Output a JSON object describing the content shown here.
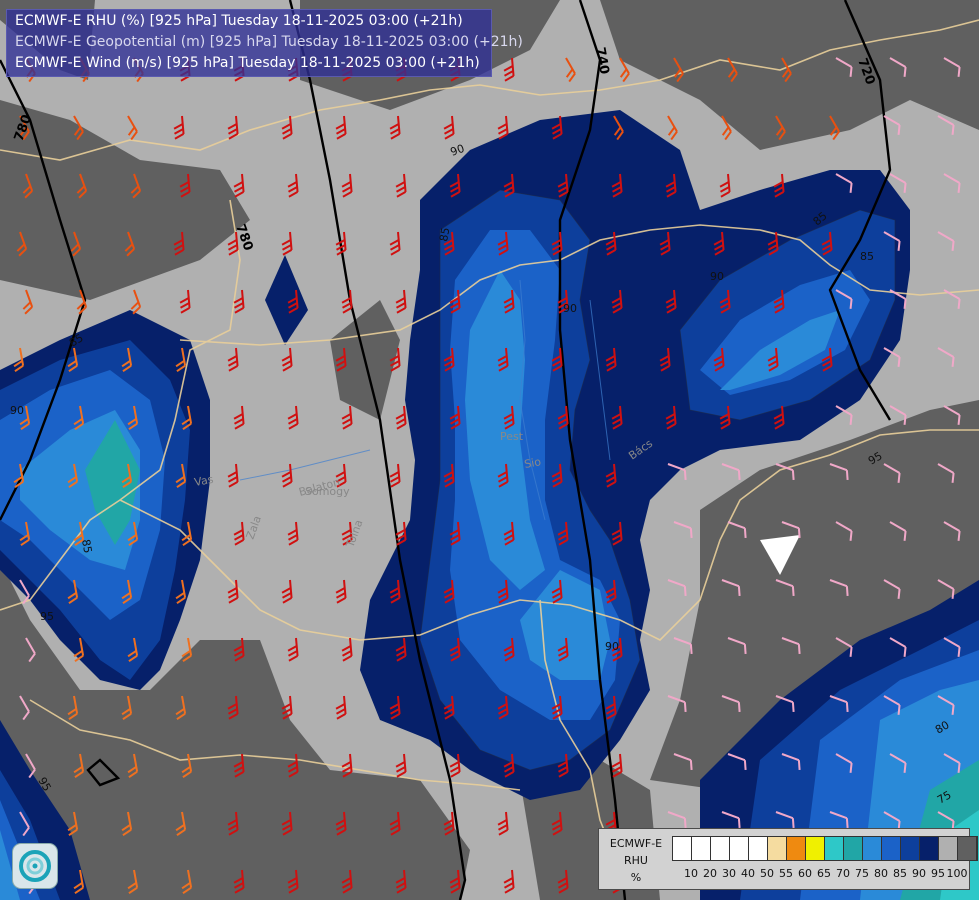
{
  "titles": {
    "rhu": "ECMWF-E RHU (%) [925 hPa] Tuesday 18-11-2025 03:00 (+21h)",
    "geopotential": "ECMWF-E Geopotential (m) [925 hPa] Tuesday 18-11-2025 03:00 (+21h)",
    "wind": "ECMWF-E Wind (m/s) [925 hPa] Tuesday 18-11-2025 03:00 (+21h)"
  },
  "legend": {
    "model": "ECMWF-E",
    "variable": "RHU",
    "unit": "%",
    "thresholds": [
      "10",
      "20",
      "30",
      "40",
      "50",
      "55",
      "60",
      "65",
      "70",
      "75",
      "80",
      "85",
      "90",
      "95",
      "100"
    ],
    "colors": [
      "#ffffff",
      "#ffffff",
      "#ffffff",
      "#ffffff",
      "#ffffff",
      "#f5dca0",
      "#ef8a10",
      "#f0f000",
      "#2ec8c8",
      "#21a6a6",
      "#2a8ad8",
      "#1b62c8",
      "#0d3f9c",
      "#06206a",
      "#b0b0b0",
      "#606060"
    ]
  },
  "height_labels": [
    "780",
    "780",
    "720",
    "740"
  ],
  "rhu_labels": [
    "90",
    "85",
    "85",
    "90",
    "85",
    "90",
    "95",
    "85",
    "90",
    "85",
    "90",
    "95",
    "80",
    "75",
    "95"
  ],
  "place_labels": [
    "Balaton",
    "Sio",
    "Somogy",
    "Tolna",
    "Zala",
    "Bács",
    "Pest",
    "Vas"
  ]
}
